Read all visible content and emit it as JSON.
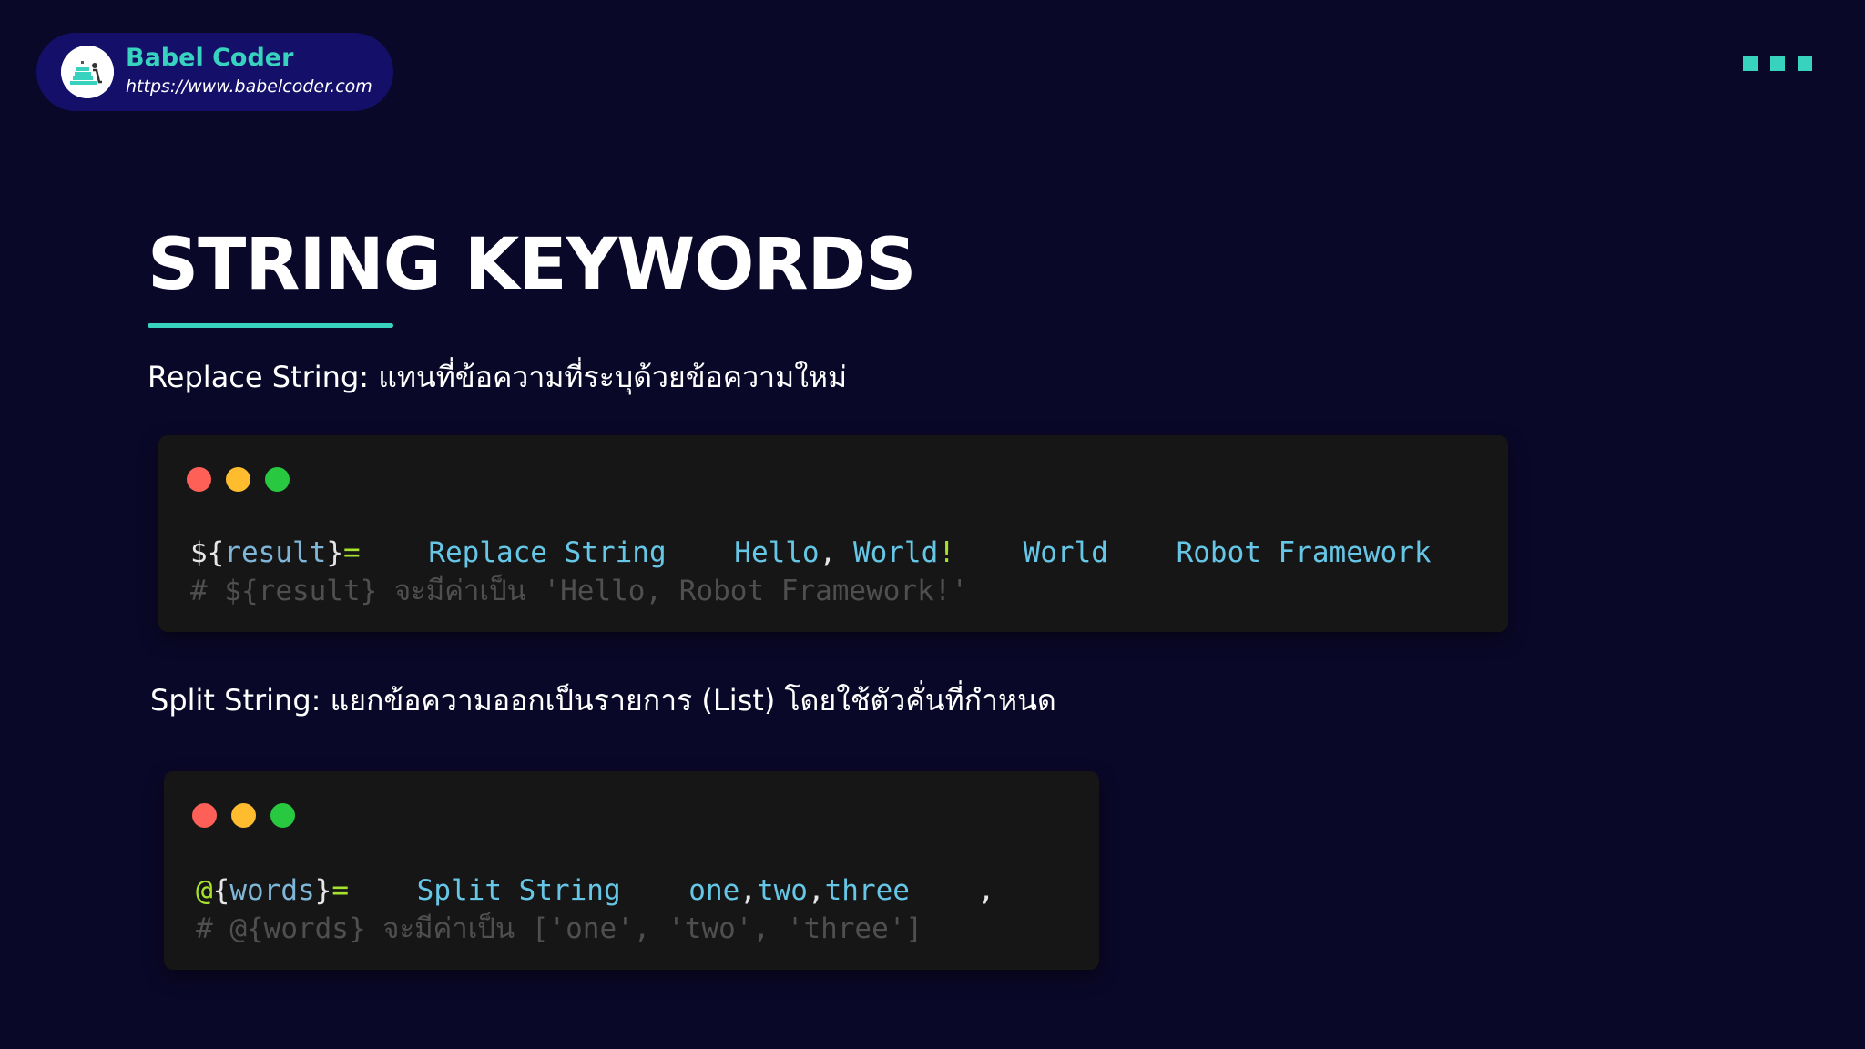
{
  "brand": {
    "name": "Babel Coder",
    "url": "https://www.babelcoder.com"
  },
  "colors": {
    "background": "#0a0828",
    "accent": "#37d3bf",
    "brand_pill": "#14106a",
    "code_background": "#161616"
  },
  "icons": {
    "brand_logo": "babel-coder-logo",
    "corner": "three-squares-icon",
    "window_controls": [
      "close-dot",
      "minimize-dot",
      "maximize-dot"
    ]
  },
  "title": "STRING KEYWORDS",
  "sections": [
    {
      "description": "Replace String: แทนที่ข้อความที่ระบุด้วยข้อความใหม่",
      "code": {
        "var_sigil": "$",
        "var_open": "{",
        "var_name": "result",
        "var_close": "}",
        "assign": "=",
        "gap_1": "    ",
        "keyword": "Replace String",
        "gap_2": "    ",
        "arg_1_a": "Hello",
        "arg_1_comma": ",",
        "arg_1_b": " World",
        "arg_1_bang": "!",
        "gap_3": "    ",
        "arg_2": "World",
        "gap_4": "    ",
        "arg_3": "Robot Framework",
        "comment": "# ${result} จะมีค่าเป็น 'Hello, Robot Framework!'"
      }
    },
    {
      "description": "Split String: แยกข้อความออกเป็นรายการ (List) โดยใช้ตัวคั่นที่กำหนด",
      "code": {
        "var_sigil": "@",
        "var_open": "{",
        "var_name": "words",
        "var_close": "}",
        "assign": "=",
        "gap_1": "    ",
        "keyword": "Split String",
        "gap_2": "    ",
        "arg_1_a": "one",
        "arg_1_c1": ",",
        "arg_1_b": "two",
        "arg_1_c2": ",",
        "arg_1_c": "three",
        "gap_3": "    ",
        "arg_2": ",",
        "comment": "# @{words} จะมีค่าเป็น ['one', 'two', 'three']"
      }
    }
  ]
}
